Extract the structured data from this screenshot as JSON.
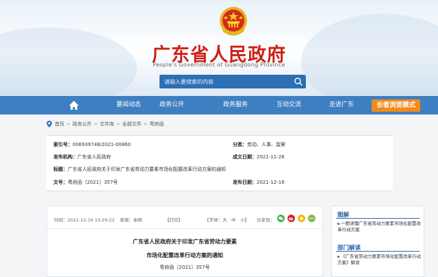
{
  "header": {
    "title": "广东省人民政府",
    "subtitle": "People's Government of Guangdong Province",
    "search_placeholder": "请输入要搜索的内容"
  },
  "nav": {
    "items": [
      "要闻动态",
      "政务公开",
      "政务服务",
      "互动交流",
      "走进广东"
    ],
    "elder_mode": "长者浏览模式"
  },
  "breadcrumb": [
    "首页",
    "政务公开",
    "文件库",
    "全部文件",
    "粤府函"
  ],
  "info": {
    "index_label": "索引号：",
    "index_value": "006939748/2021-00860",
    "category_label": "分类：",
    "category_value": "劳动、人事、监察",
    "issuer_label": "发布机构：",
    "issuer_value": "广东省人民政府",
    "created_label": "成文日期：",
    "created_value": "2021-11-26",
    "title_label": "标题：",
    "title_value": "广东省人民政府关于印发广东省劳动力要素市场化配置改革行动方案的通知",
    "docno_label": "文号：",
    "docno_value": "粤府函〔2021〕357号",
    "published_label": "发布日期：",
    "published_value": "2021-12-16"
  },
  "article": {
    "time": "时间：2021-12-16 10:29:22",
    "source": "来源：本网",
    "print": "【打印】",
    "font_size": "【字体：大　中　小】",
    "share_label": "分享到：",
    "title_line1": "广东省人民政府关于印发广东省劳动力要素",
    "title_line2": "市场化配置改革行动方案的通知",
    "doc_number": "粤府函〔2021〕357号"
  },
  "sidebar": {
    "graphic_heading": "图解",
    "graphic_link": "一图读懂广东省劳动力要素市场化配置改革行动方案",
    "dept_heading": "部门解读",
    "dept_link": "《广东省劳动力要素市场化配置改革行动方案》解读"
  },
  "colors": {
    "brand_red": "#cf1f17",
    "nav_blue": "#3e7fc1",
    "elder_orange": "#f28a1b",
    "link_blue": "#2b67a8"
  }
}
